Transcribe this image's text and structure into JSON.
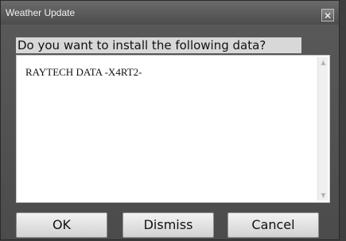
{
  "window": {
    "title": "Weather Update",
    "close_glyph": "✕"
  },
  "dialog": {
    "question": "Do you want to install the following data?",
    "content_text": "RAYTECH DATA -X4RT2-",
    "scroll_up_glyph": "▲",
    "scroll_down_glyph": "▼"
  },
  "buttons": {
    "ok": "OK",
    "dismiss": "Dismiss",
    "cancel": "Cancel"
  }
}
